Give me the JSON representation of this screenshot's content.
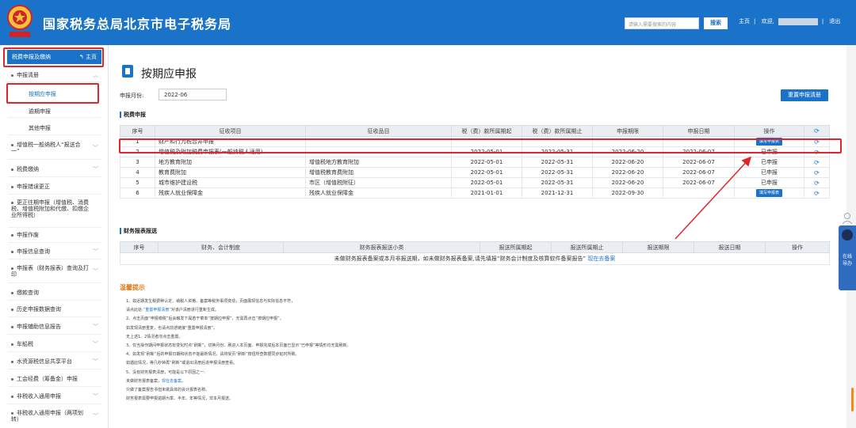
{
  "header": {
    "title": "国家税务总局北京市电子税务局",
    "search_placeholder": "请输入需要搜索的内容",
    "search_button": "搜索",
    "home_link": "主页",
    "welcome": "欢迎,",
    "logout": "退出"
  },
  "sidebar": {
    "top_label": "税费申报及缴纳",
    "home_label": "主页",
    "items": [
      {
        "label": "申报清册",
        "expandable": true
      },
      {
        "label": "按期应申报",
        "sub": true,
        "active": true
      },
      {
        "label": "逾期申报",
        "sub": true
      },
      {
        "label": "其他申报",
        "sub": true
      },
      {
        "label": "增值税一般纳税人“报送合一”",
        "expandable": true
      },
      {
        "label": "税费缴纳",
        "expandable": true
      },
      {
        "label": "申报错误更正"
      },
      {
        "label": "更正往期申报（增值税、消费税、增值税附加和代缴、扣缴企业所得税）"
      },
      {
        "label": "申报作废"
      },
      {
        "label": "申报信息查询",
        "expandable": true
      },
      {
        "label": "申报表（财务报表）查询及打印",
        "expandable": true
      },
      {
        "label": "缴款查询"
      },
      {
        "label": "历史申报数据查询"
      },
      {
        "label": "申报辅助信息报告",
        "expandable": true
      },
      {
        "label": "车船税",
        "expandable": true
      },
      {
        "label": "水资源税信息共享平台",
        "expandable": true
      },
      {
        "label": "工会经费（筹备金）申报"
      },
      {
        "label": "非税收入通用申报",
        "expandable": true
      },
      {
        "label": "非税收入通用申报（两项划转）",
        "expandable": true
      }
    ]
  },
  "main": {
    "page_title": "按期应申报",
    "month_label": "申报月份:",
    "month_value": "2022-06",
    "reset_button": "重置申报清册",
    "tax_section": "税费申报",
    "tax_headers": [
      "序号",
      "征收项目",
      "征收品目",
      "税（费）款所属期起",
      "税（费）款所属期止",
      "申报期限",
      "申报日期",
      "操作"
    ],
    "tax_rows": [
      {
        "no": "1",
        "item": "财产和行为税合并申报",
        "sub": "",
        "start": "",
        "end": "",
        "deadline": "",
        "date": "",
        "op": "填写申报表",
        "op_button": true
      },
      {
        "no": "2",
        "item": "增值税及附加税费申报表(一般纳税人适用)",
        "sub": "",
        "start": "2022-05-01",
        "end": "2022-05-31",
        "deadline": "2022-06-20",
        "date": "2022-06-07",
        "op": "已申报",
        "op_button": false
      },
      {
        "no": "3",
        "item": "地方教育附加",
        "sub": "增值税地方教育附加",
        "start": "2022-05-01",
        "end": "2022-05-31",
        "deadline": "2022-06-20",
        "date": "2022-06-07",
        "op": "已申报",
        "op_button": false
      },
      {
        "no": "4",
        "item": "教育费附加",
        "sub": "增值税教育费附加",
        "start": "2022-05-01",
        "end": "2022-05-31",
        "deadline": "2022-06-20",
        "date": "2022-06-07",
        "op": "已申报",
        "op_button": false
      },
      {
        "no": "5",
        "item": "城市维护建设税",
        "sub": "市区（增值税附征）",
        "start": "2022-05-01",
        "end": "2022-05-31",
        "deadline": "2022-06-20",
        "date": "2022-06-07",
        "op": "已申报",
        "op_button": false
      },
      {
        "no": "6",
        "item": "残疾人就业保障金",
        "sub": "残疾人就业保障金",
        "start": "2021-01-01",
        "end": "2021-12-31",
        "deadline": "2022-09-30",
        "date": "",
        "op": "填写申报表",
        "op_button": true
      }
    ],
    "fin_section": "财务报表报送",
    "fin_headers": [
      "序号",
      "财务、会计制度",
      "财务报表报送小类",
      "报送所属期起",
      "报送所属期止",
      "报送期限",
      "报送日期",
      "操作"
    ],
    "fin_note": "未做财务报表备案或本月非报送期，如未做财务报表备案,请先填报“财务会计制度及核算软件备案报告”",
    "fin_link": "现在去备案",
    "tips_title": "温馨提示",
    "tips": [
      {
        "text": "1、如近期发生税费种认定、纳税人资格、备案等税务事项变动，页面展现信息与实际信息不符，"
      },
      {
        "text": "请点此处:",
        "link": "“重置申报清册”",
        "after": "对该户清册进行重新生成。"
      },
      {
        "text": "2、点击页面“申报缴税”后会触发下属若干菜单“按期应申报”，无需再点击“按期应申报”。"
      },
      {
        "text": "如发现清册重复，也请点前述链接“重置申报清册”。"
      },
      {
        "text": "无上述1、2情况者勿点击重置。"
      },
      {
        "text": "3、仅当操作期间申报状态有变化时点“刷新”，切换月份、刷进入本页面、申报完成后本页面已显示“已申报”等情形均无需刷新。"
      },
      {
        "text": "4、如发现“刷新”后的申报日期和状态不能最新情况，请将受页“刷新”按钮所查数据同步延时所致。"
      },
      {
        "text": "如遇此情况，等几秒钟再“刷新”或退出清册后进申报清册查看。"
      },
      {
        "text": "5、没有财务报表清册，可能是以下原因之一:"
      },
      {
        "text": "未做财务报表备案，",
        "link": "现在去备案",
        "after": "。"
      },
      {
        "text": "只做了备案报告书但未做具体的会计报表名称。"
      },
      {
        "text": "财务报表需要申报逾期为季、半年、年等情况，非本月报送。"
      }
    ]
  },
  "helper": {
    "text": "在线导办"
  },
  "colors": {
    "brand": "#1b73c9",
    "highlight": "#e0262c",
    "tips": "#e07b19"
  }
}
